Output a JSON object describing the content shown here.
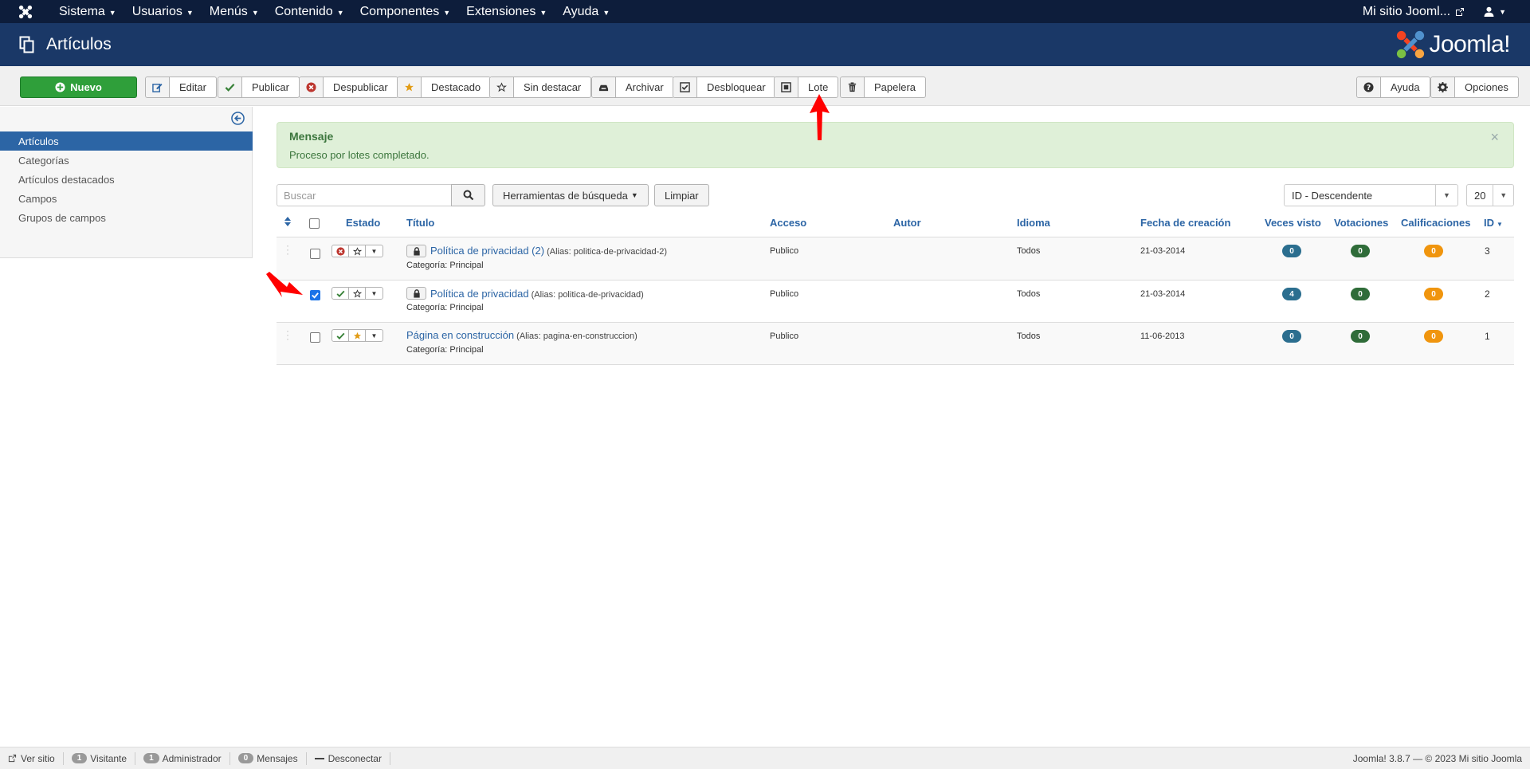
{
  "topnav": {
    "menu": [
      "Sistema",
      "Usuarios",
      "Menús",
      "Contenido",
      "Componentes",
      "Extensiones",
      "Ayuda"
    ],
    "site_link": "Mi sitio Jooml..."
  },
  "header": {
    "title": "Artículos",
    "brand": "Joomla!"
  },
  "toolbar": {
    "new": "Nuevo",
    "edit": "Editar",
    "publish": "Publicar",
    "unpublish": "Despublicar",
    "featured": "Destacado",
    "unfeatured": "Sin destacar",
    "archive": "Archivar",
    "checkin": "Desbloquear",
    "batch": "Lote",
    "trash": "Papelera",
    "help": "Ayuda",
    "options": "Opciones"
  },
  "sidebar": {
    "items": [
      "Artículos",
      "Categorías",
      "Artículos destacados",
      "Campos",
      "Grupos de campos"
    ]
  },
  "message": {
    "heading": "Mensaje",
    "text": "Proceso por lotes completado.",
    "close": "×"
  },
  "filters": {
    "search_placeholder": "Buscar",
    "search_tools": "Herramientas de búsqueda",
    "clear": "Limpiar",
    "ordering": "ID - Descendente",
    "limit": "20"
  },
  "table": {
    "headers": {
      "status": "Estado",
      "title": "Título",
      "access": "Acceso",
      "author": "Autor",
      "language": "Idioma",
      "created": "Fecha de creación",
      "hits": "Veces visto",
      "votes": "Votaciones",
      "ratings": "Calificaciones",
      "id": "ID"
    },
    "rows": [
      {
        "title": "Política de privacidad (2)",
        "alias": "(Alias: politica-de-privacidad-2)",
        "category": "Categoría: Principal",
        "access": "Publico",
        "language": "Todos",
        "created": "21-03-2014",
        "hits": "0",
        "votes": "0",
        "ratings": "0",
        "id": "3"
      },
      {
        "title": "Política de privacidad",
        "alias": "(Alias: politica-de-privacidad)",
        "category": "Categoría: Principal",
        "access": "Publico",
        "language": "Todos",
        "created": "21-03-2014",
        "hits": "4",
        "votes": "0",
        "ratings": "0",
        "id": "2"
      },
      {
        "title": "Página en construcción",
        "alias": "(Alias: pagina-en-construccion)",
        "category": "Categoría: Principal",
        "access": "Publico",
        "language": "Todos",
        "created": "11-06-2013",
        "hits": "0",
        "votes": "0",
        "ratings": "0",
        "id": "1"
      }
    ]
  },
  "footer": {
    "view_site": "Ver sitio",
    "visitors_count": "1",
    "visitors": "Visitante",
    "admins_count": "1",
    "admins": "Administrador",
    "messages_count": "0",
    "messages": "Mensajes",
    "logout": "Desconectar",
    "copyright": "Joomla! 3.8.7  —  © 2023 Mi sitio Joomla"
  },
  "colors": {
    "topnav": "#0d1d3b",
    "header": "#1a3867",
    "new_button": "#2f9f3a",
    "link": "#2c65a5",
    "success_bg": "#dff0d8"
  }
}
